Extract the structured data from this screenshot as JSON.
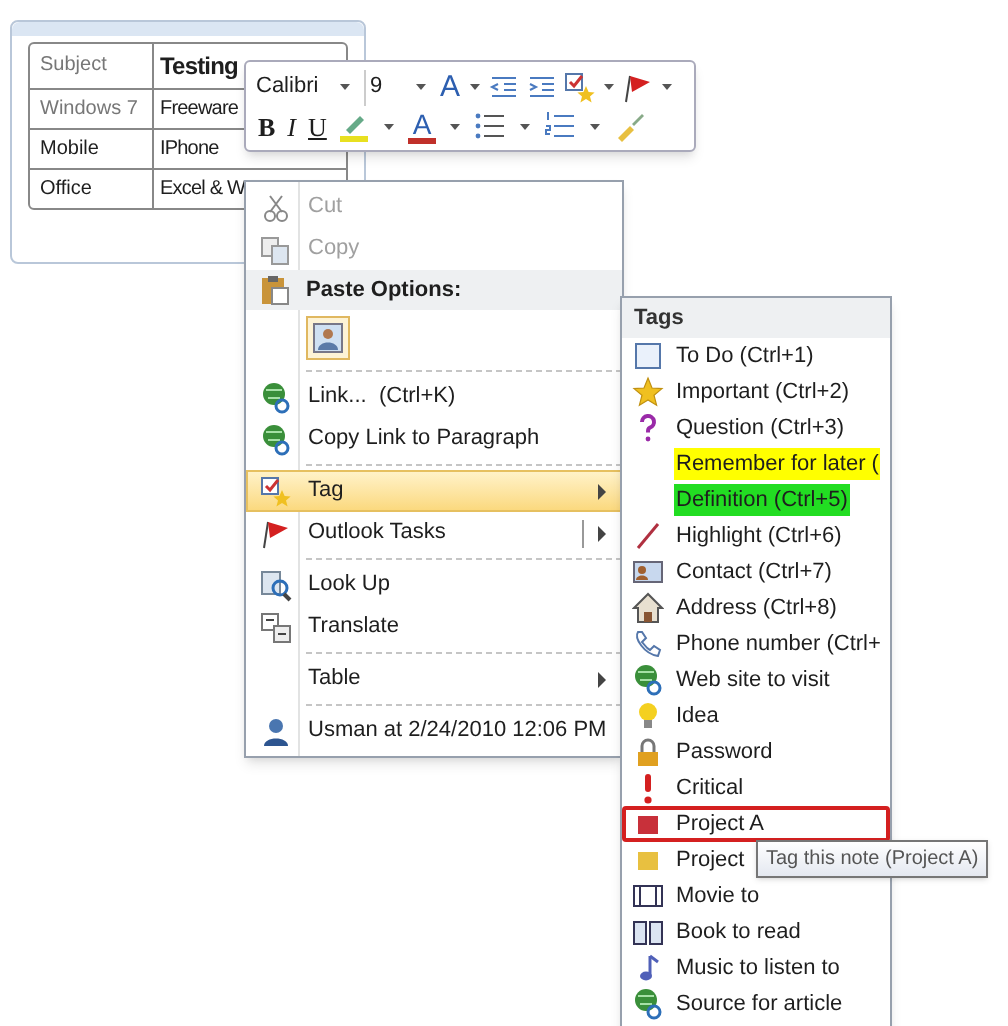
{
  "note": {
    "rows": [
      {
        "dimmed": true,
        "header": true,
        "cells": [
          "Subject",
          "Testing"
        ]
      },
      {
        "dimmed": true,
        "header": false,
        "cells": [
          "Windows 7",
          "Freeware"
        ]
      },
      {
        "dimmed": false,
        "header": false,
        "cells": [
          "Mobile",
          "IPhone"
        ]
      },
      {
        "dimmed": false,
        "header": false,
        "cells": [
          "Office",
          "Excel & W"
        ]
      }
    ]
  },
  "mini_toolbar": {
    "font": "Calibri",
    "size": "9",
    "grow_font": "A",
    "format_buttons": [
      "B",
      "I",
      "U"
    ],
    "font_color": "A"
  },
  "context_menu": {
    "items": [
      {
        "kind": "item",
        "label": "Cut",
        "disabled": true,
        "selected": false,
        "submenu": false,
        "split": false
      },
      {
        "kind": "item",
        "label": "Copy",
        "disabled": true,
        "selected": false,
        "submenu": false,
        "split": false
      },
      {
        "kind": "header",
        "label": "Paste Options:"
      },
      {
        "kind": "paste"
      },
      {
        "kind": "separator"
      },
      {
        "kind": "item",
        "label": "Link...  (Ctrl+K)",
        "disabled": false,
        "selected": false,
        "submenu": false,
        "split": false
      },
      {
        "kind": "item",
        "label": "Copy Link to Paragraph",
        "disabled": false,
        "selected": false,
        "submenu": false,
        "split": false
      },
      {
        "kind": "separator"
      },
      {
        "kind": "item",
        "label": "Tag",
        "disabled": false,
        "selected": true,
        "submenu": true,
        "split": false
      },
      {
        "kind": "item",
        "label": "Outlook Tasks",
        "disabled": false,
        "selected": false,
        "submenu": true,
        "split": true
      },
      {
        "kind": "separator"
      },
      {
        "kind": "item",
        "label": "Look Up",
        "disabled": false,
        "selected": false,
        "submenu": false,
        "split": false
      },
      {
        "kind": "item",
        "label": "Translate",
        "disabled": false,
        "selected": false,
        "submenu": false,
        "split": false
      },
      {
        "kind": "separator"
      },
      {
        "kind": "item",
        "label": "Table",
        "disabled": false,
        "selected": false,
        "submenu": true,
        "split": false
      },
      {
        "kind": "separator"
      },
      {
        "kind": "item",
        "label": "Usman at 2/24/2010 12:06 PM",
        "disabled": false,
        "selected": false,
        "submenu": false,
        "split": false
      }
    ]
  },
  "tags_menu": {
    "title": "Tags",
    "items": [
      {
        "label": "To Do (Ctrl+1)",
        "selected": false
      },
      {
        "label": "Important (Ctrl+2)",
        "selected": false
      },
      {
        "label": "Question (Ctrl+3)",
        "selected": false
      },
      {
        "label": "Remember for later (",
        "selected": false,
        "color": "#ffff00"
      },
      {
        "label": "Definition (Ctrl+5)",
        "selected": false,
        "color": "#22dd22"
      },
      {
        "label": "Highlight (Ctrl+6)",
        "selected": false
      },
      {
        "label": "Contact (Ctrl+7)",
        "selected": false
      },
      {
        "label": "Address (Ctrl+8)",
        "selected": false
      },
      {
        "label": "Phone number (Ctrl+",
        "selected": false
      },
      {
        "label": "Web site to visit",
        "selected": false
      },
      {
        "label": "Idea",
        "selected": false
      },
      {
        "label": "Password",
        "selected": false
      },
      {
        "label": "Critical",
        "selected": false
      },
      {
        "label": "Project A",
        "selected": true
      },
      {
        "label": "Project",
        "selected": false
      },
      {
        "label": "Movie to",
        "selected": false
      },
      {
        "label": "Book to read",
        "selected": false
      },
      {
        "label": "Music to listen to",
        "selected": false
      },
      {
        "label": "Source for article",
        "selected": false
      }
    ]
  },
  "tooltip": {
    "text": "Tag this note (Project A)"
  }
}
